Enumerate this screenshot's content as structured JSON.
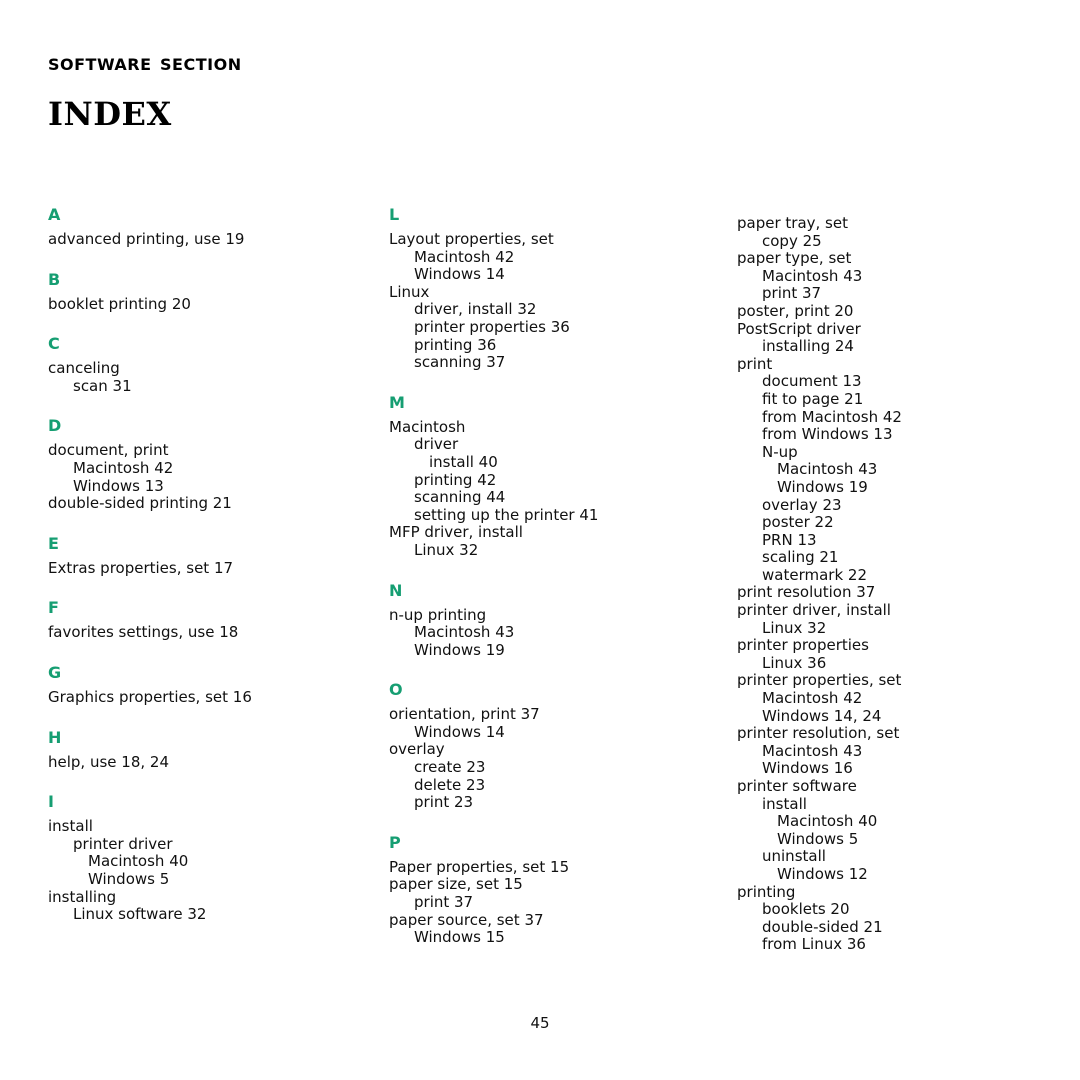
{
  "header": {
    "kicker": "Software Section",
    "title": "Index"
  },
  "footer": {
    "page_number": "45"
  },
  "accent_color": "#169e72",
  "columns": [
    {
      "name": "column-1",
      "groups": [
        {
          "letter": "A",
          "entries": [
            {
              "level": 0,
              "text": "advanced printing, use 19"
            }
          ]
        },
        {
          "letter": "B",
          "entries": [
            {
              "level": 0,
              "text": "booklet printing 20"
            }
          ]
        },
        {
          "letter": "C",
          "entries": [
            {
              "level": 0,
              "text": "canceling"
            },
            {
              "level": 1,
              "text": "scan 31"
            }
          ]
        },
        {
          "letter": "D",
          "entries": [
            {
              "level": 0,
              "text": "document, print"
            },
            {
              "level": 1,
              "text": "Macintosh 42"
            },
            {
              "level": 1,
              "text": "Windows 13"
            },
            {
              "level": 0,
              "text": "double-sided printing 21"
            }
          ]
        },
        {
          "letter": "E",
          "entries": [
            {
              "level": 0,
              "text": "Extras properties, set 17"
            }
          ]
        },
        {
          "letter": "F",
          "entries": [
            {
              "level": 0,
              "text": "favorites settings, use 18"
            }
          ]
        },
        {
          "letter": "G",
          "entries": [
            {
              "level": 0,
              "text": "Graphics properties, set 16"
            }
          ]
        },
        {
          "letter": "H",
          "entries": [
            {
              "level": 0,
              "text": "help, use 18, 24"
            }
          ]
        },
        {
          "letter": "I",
          "entries": [
            {
              "level": 0,
              "text": "install"
            },
            {
              "level": 1,
              "text": "printer driver"
            },
            {
              "level": 2,
              "text": "Macintosh 40"
            },
            {
              "level": 2,
              "text": "Windows 5"
            },
            {
              "level": 0,
              "text": "installing"
            },
            {
              "level": 1,
              "text": "Linux software 32"
            }
          ]
        }
      ]
    },
    {
      "name": "column-2",
      "groups": [
        {
          "letter": "L",
          "entries": [
            {
              "level": 0,
              "text": "Layout properties, set"
            },
            {
              "level": 1,
              "text": "Macintosh 42"
            },
            {
              "level": 1,
              "text": "Windows 14"
            },
            {
              "level": 0,
              "text": "Linux"
            },
            {
              "level": 1,
              "text": "driver, install 32"
            },
            {
              "level": 1,
              "text": "printer properties 36"
            },
            {
              "level": 1,
              "text": "printing 36"
            },
            {
              "level": 1,
              "text": "scanning 37"
            }
          ]
        },
        {
          "letter": "M",
          "entries": [
            {
              "level": 0,
              "text": "Macintosh"
            },
            {
              "level": 1,
              "text": "driver"
            },
            {
              "level": 2,
              "text": "install 40"
            },
            {
              "level": 1,
              "text": "printing 42"
            },
            {
              "level": 1,
              "text": "scanning 44"
            },
            {
              "level": 1,
              "text": "setting up the printer 41"
            },
            {
              "level": 0,
              "text": "MFP driver, install"
            },
            {
              "level": 1,
              "text": "Linux 32"
            }
          ]
        },
        {
          "letter": "N",
          "entries": [
            {
              "level": 0,
              "text": "n-up printing"
            },
            {
              "level": 1,
              "text": "Macintosh 43"
            },
            {
              "level": 1,
              "text": "Windows 19"
            }
          ]
        },
        {
          "letter": "O",
          "entries": [
            {
              "level": 0,
              "text": "orientation, print 37"
            },
            {
              "level": 1,
              "text": "Windows 14"
            },
            {
              "level": 0,
              "text": "overlay"
            },
            {
              "level": 1,
              "text": "create 23"
            },
            {
              "level": 1,
              "text": "delete 23"
            },
            {
              "level": 1,
              "text": "print 23"
            }
          ]
        },
        {
          "letter": "P",
          "entries": [
            {
              "level": 0,
              "text": "Paper properties, set 15"
            },
            {
              "level": 0,
              "text": "paper size, set 15"
            },
            {
              "level": 1,
              "text": "print 37"
            },
            {
              "level": 0,
              "text": "paper source, set 37"
            },
            {
              "level": 1,
              "text": "Windows 15"
            }
          ]
        }
      ]
    },
    {
      "name": "column-3",
      "groups": [
        {
          "letter": "",
          "entries": [
            {
              "level": 0,
              "text": "paper tray, set"
            },
            {
              "level": 1,
              "text": "copy 25"
            },
            {
              "level": 0,
              "text": "paper type, set"
            },
            {
              "level": 1,
              "text": "Macintosh 43"
            },
            {
              "level": 1,
              "text": "print 37"
            },
            {
              "level": 0,
              "text": "poster, print 20"
            },
            {
              "level": 0,
              "text": "PostScript driver"
            },
            {
              "level": 1,
              "text": "installing 24"
            },
            {
              "level": 0,
              "text": "print"
            },
            {
              "level": 1,
              "text": "document 13"
            },
            {
              "level": 1,
              "text": "fit to page 21"
            },
            {
              "level": 1,
              "text": "from Macintosh 42"
            },
            {
              "level": 1,
              "text": "from Windows 13"
            },
            {
              "level": 1,
              "text": "N-up"
            },
            {
              "level": 2,
              "text": "Macintosh 43"
            },
            {
              "level": 2,
              "text": "Windows 19"
            },
            {
              "level": 1,
              "text": "overlay 23"
            },
            {
              "level": 1,
              "text": "poster 22"
            },
            {
              "level": 1,
              "text": "PRN 13"
            },
            {
              "level": 1,
              "text": "scaling 21"
            },
            {
              "level": 1,
              "text": "watermark 22"
            },
            {
              "level": 0,
              "text": "print resolution 37"
            },
            {
              "level": 0,
              "text": "printer driver, install"
            },
            {
              "level": 1,
              "text": "Linux 32"
            },
            {
              "level": 0,
              "text": "printer properties"
            },
            {
              "level": 1,
              "text": "Linux 36"
            },
            {
              "level": 0,
              "text": "printer properties, set"
            },
            {
              "level": 1,
              "text": "Macintosh 42"
            },
            {
              "level": 1,
              "text": "Windows 14, 24"
            },
            {
              "level": 0,
              "text": "printer resolution, set"
            },
            {
              "level": 1,
              "text": "Macintosh 43"
            },
            {
              "level": 1,
              "text": "Windows 16"
            },
            {
              "level": 0,
              "text": "printer software"
            },
            {
              "level": 1,
              "text": "install"
            },
            {
              "level": 2,
              "text": "Macintosh 40"
            },
            {
              "level": 2,
              "text": "Windows 5"
            },
            {
              "level": 1,
              "text": "uninstall"
            },
            {
              "level": 2,
              "text": "Windows 12"
            },
            {
              "level": 0,
              "text": "printing"
            },
            {
              "level": 1,
              "text": "booklets 20"
            },
            {
              "level": 1,
              "text": "double-sided 21"
            },
            {
              "level": 1,
              "text": "from Linux 36"
            }
          ]
        }
      ]
    }
  ]
}
